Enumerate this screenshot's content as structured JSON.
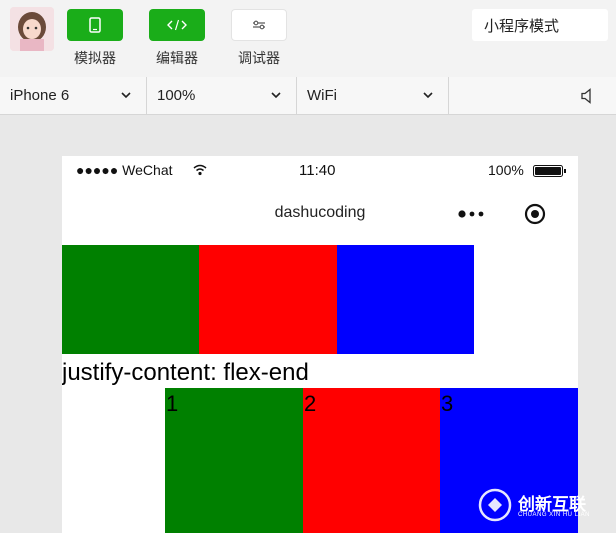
{
  "toolbar": {
    "buttons": [
      {
        "label": "模拟器",
        "icon": "phone-icon",
        "style": "green"
      },
      {
        "label": "编辑器",
        "icon": "code-icon",
        "style": "green"
      },
      {
        "label": "调试器",
        "icon": "sliders-icon",
        "style": "white"
      }
    ],
    "mode_select": "小程序模式"
  },
  "device_bar": {
    "device": "iPhone 6",
    "zoom": "100%",
    "network": "WiFi",
    "sound_icon": "speaker-icon"
  },
  "simulator": {
    "status_bar": {
      "carrier": "●●●●● WeChat",
      "time": "11:40",
      "battery": "100%"
    },
    "nav_title": "dashucoding",
    "section1": {
      "colors": [
        "#008000",
        "#ff0000",
        "#0000ff"
      ]
    },
    "caption": "justify-content: flex-end",
    "section2": {
      "items": [
        {
          "label": "1",
          "color": "#008000"
        },
        {
          "label": "2",
          "color": "#ff0000"
        },
        {
          "label": "3",
          "color": "#0000ff"
        }
      ]
    }
  },
  "watermark": {
    "text": "创新互联",
    "subtext": "CHUANG XIN HU LIAN"
  }
}
